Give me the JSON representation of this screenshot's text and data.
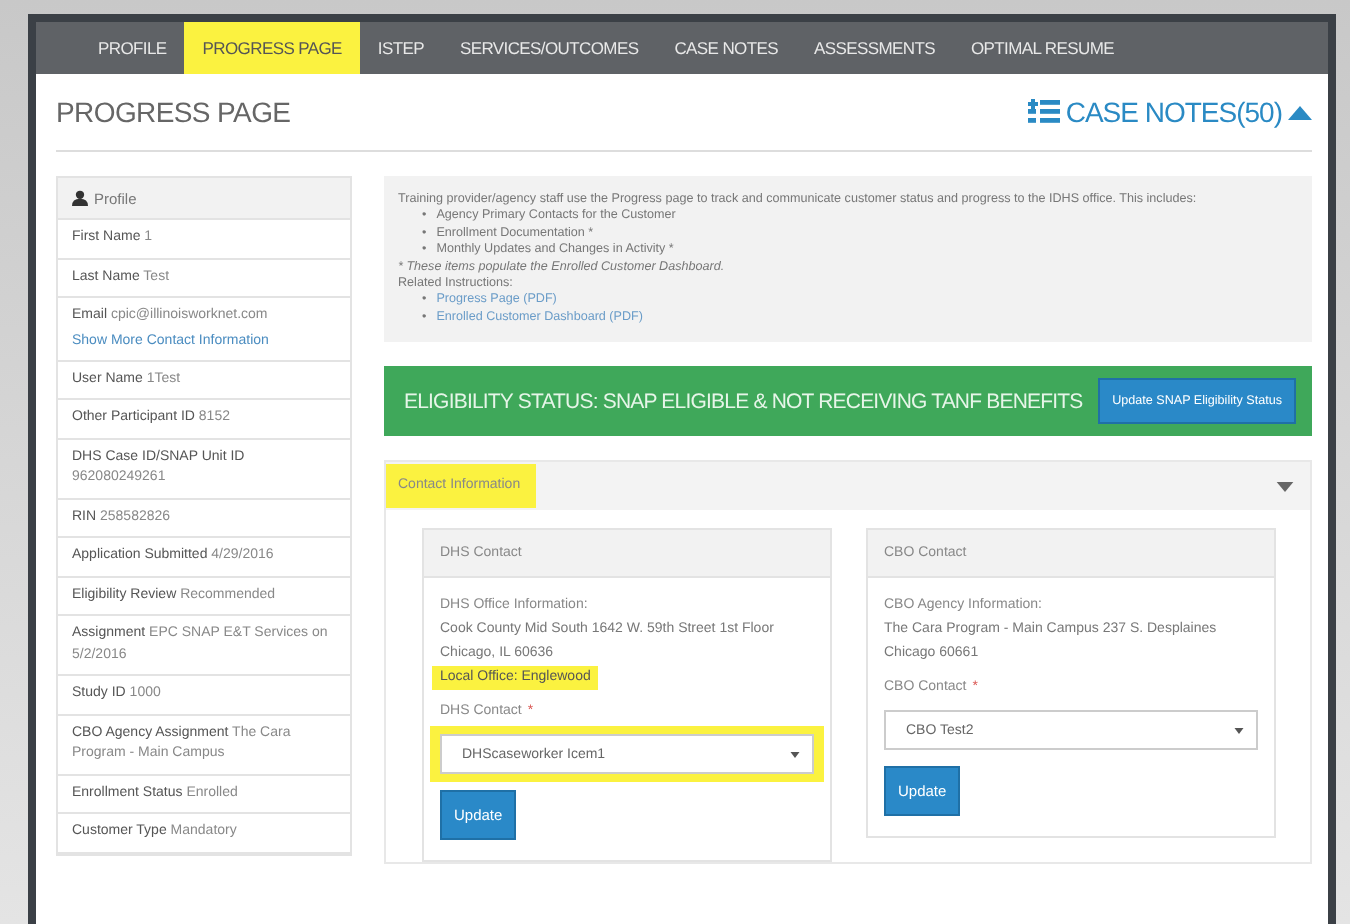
{
  "nav": {
    "tabs": [
      {
        "label": "PROFILE",
        "selected": false,
        "highlighted": false
      },
      {
        "label": "PROGRESS PAGE",
        "selected": true,
        "highlighted": true
      },
      {
        "label": "ISTEP",
        "selected": false,
        "highlighted": false
      },
      {
        "label": "SERVICES/OUTCOMES",
        "selected": false,
        "highlighted": false
      },
      {
        "label": "CASE NOTES",
        "selected": false,
        "highlighted": false
      },
      {
        "label": "ASSESSMENTS",
        "selected": false,
        "highlighted": false
      },
      {
        "label": "OPTIMAL RESUME",
        "selected": false,
        "highlighted": false
      }
    ]
  },
  "page_title": "PROGRESS PAGE",
  "case_notes_link": "CASE NOTES(50)",
  "sidebar": {
    "title": "Profile",
    "items": [
      {
        "label": "First Name",
        "value": "1"
      },
      {
        "label": "Last Name",
        "value": "Test"
      },
      {
        "label": "Email",
        "value": "cpic@illinoisworknet.com",
        "link": "Show More Contact Information"
      },
      {
        "label": "User Name",
        "value": "1Test"
      },
      {
        "label": "Other Participant ID",
        "value": "8152"
      },
      {
        "label": "DHS Case ID/SNAP Unit ID",
        "value": "962080249261"
      },
      {
        "label": "RIN",
        "value": "258582826"
      },
      {
        "label": "Application Submitted",
        "value": "4/29/2016"
      },
      {
        "label": "Eligibility Review",
        "value": "Recommended"
      },
      {
        "label": "Assignment",
        "value": "EPC SNAP E&T Services on 5/2/2016"
      },
      {
        "label": "Study ID",
        "value": "1000"
      },
      {
        "label": "CBO Agency Assignment",
        "value": "The Cara Program - Main Campus"
      },
      {
        "label": "Enrollment Status",
        "value": "Enrolled"
      },
      {
        "label": "Customer Type",
        "value": "Mandatory"
      }
    ]
  },
  "info": {
    "intro": "Training provider/agency staff use the Progress page to track and communicate customer status and progress to the IDHS office. This includes:",
    "marker": "•",
    "bullets": [
      "Agency Primary Contacts for the Customer",
      "Enrollment Documentation *",
      "Monthly Updates and Changes in Activity *"
    ],
    "note": "* These items populate the Enrolled Customer Dashboard.",
    "related_title": "Related Instructions:",
    "links": [
      "Progress Page (PDF)",
      "Enrolled Customer Dashboard (PDF)"
    ]
  },
  "eligibility": {
    "status": "ELIGIBILITY STATUS: SNAP ELIGIBLE & NOT RECEIVING TANF BENEFITS",
    "button": "Update SNAP Eligibility Status"
  },
  "contact": {
    "title": "Contact Information",
    "highlighted": true,
    "expanded": true,
    "panels": [
      {
        "title": "DHS Contact",
        "info_label": "DHS Office Information:",
        "address": "Cook County Mid South 1642 W. 59th Street 1st Floor Chicago, IL 60636",
        "extra": "Local Office: Englewood",
        "extra_highlighted": true,
        "select_label": "DHS Contact",
        "required_mark": "*",
        "select_value": "DHScaseworker Icem1",
        "select_highlighted": true,
        "button": "Update"
      },
      {
        "title": "CBO Contact",
        "info_label": "CBO Agency Information:",
        "address": "The Cara Program - Main Campus 237 S. Desplaines Chicago 60661",
        "select_label": "CBO Contact",
        "required_mark": "*",
        "select_value": "CBO Test2",
        "select_highlighted": false,
        "button": "Update"
      }
    ]
  }
}
